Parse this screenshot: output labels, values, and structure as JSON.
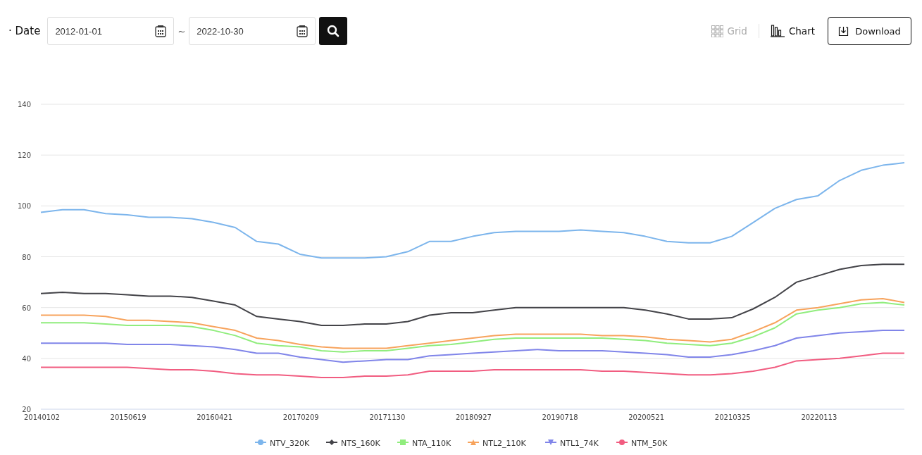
{
  "filter": {
    "label": "· Date",
    "start_date": "2012-01-01",
    "separator": "~",
    "end_date": "2022-10-30"
  },
  "view_tabs": [
    {
      "label": "Grid",
      "selected": false
    },
    {
      "label": "Chart",
      "selected": true
    }
  ],
  "download_button": "Download",
  "chart_data": {
    "type": "line",
    "categories": [
      "20140102",
      null,
      null,
      null,
      "20150619",
      null,
      null,
      null,
      "20160421",
      null,
      null,
      null,
      "20170209",
      null,
      null,
      null,
      "20171130",
      null,
      null,
      null,
      "20180927",
      null,
      null,
      null,
      "20190718",
      null,
      null,
      null,
      "20200521",
      null,
      null,
      null,
      "20210325",
      null,
      null,
      null,
      "20220113",
      null,
      null,
      null,
      null
    ],
    "ylim": [
      20,
      140
    ],
    "grid": true,
    "legend": "bottom",
    "yticks": [
      20,
      40,
      60,
      80,
      100,
      120,
      140
    ],
    "series": [
      {
        "name": "NTV_320K",
        "color": "#7cb5ec",
        "values": [
          97.5,
          98.5,
          98.5,
          97,
          96.5,
          95.5,
          95.5,
          95,
          93.5,
          91.5,
          86,
          85,
          81,
          79.5,
          79.5,
          79.5,
          80,
          82,
          86,
          86,
          88,
          89.5,
          90,
          90,
          90,
          90.5,
          90,
          89.5,
          88,
          86,
          85.5,
          85.5,
          88,
          93.5,
          99,
          102.5,
          104,
          110,
          114,
          116,
          117
        ]
      },
      {
        "name": "NTS_160K",
        "color": "#434348",
        "values": [
          65.5,
          66,
          65.5,
          65.5,
          65,
          64.5,
          64.5,
          64,
          62.5,
          61,
          56.5,
          55.5,
          54.5,
          53,
          53,
          53.5,
          53.5,
          54.5,
          57,
          58,
          58,
          59,
          60,
          60,
          60,
          60,
          60,
          60,
          59,
          57.5,
          55.5,
          55.5,
          56,
          59.5,
          64,
          70,
          72.5,
          75,
          76.5,
          77,
          77
        ]
      },
      {
        "name": "NTA_110K",
        "color": "#90ed7d",
        "values": [
          54,
          54,
          54,
          53.5,
          53,
          53,
          53,
          52.5,
          51,
          49,
          46,
          45,
          44.5,
          43,
          42.5,
          43,
          43,
          44,
          45,
          45.5,
          46.5,
          47.5,
          48,
          48,
          48,
          48,
          48,
          47.5,
          47,
          46,
          45.5,
          45,
          46,
          48.5,
          52,
          57.5,
          59,
          60,
          61.5,
          62,
          61
        ]
      },
      {
        "name": "NTL2_110K",
        "color": "#f7a35c",
        "values": [
          57,
          57,
          57,
          56.5,
          55,
          55,
          54.5,
          54,
          52.5,
          51,
          48,
          47,
          45.5,
          44.5,
          44,
          44,
          44,
          45,
          46,
          47,
          48,
          49,
          49.5,
          49.5,
          49.5,
          49.5,
          49,
          49,
          48.5,
          47.5,
          47,
          46.5,
          47.5,
          50.5,
          54,
          59,
          60,
          61.5,
          63,
          63.5,
          62
        ]
      },
      {
        "name": "NTL1_74K",
        "color": "#8085e9",
        "values": [
          46,
          46,
          46,
          46,
          45.5,
          45.5,
          45.5,
          45,
          44.5,
          43.5,
          42,
          42,
          40.5,
          39.5,
          38.5,
          39,
          39.5,
          39.5,
          41,
          41.5,
          42,
          42.5,
          43,
          43.5,
          43,
          43,
          43,
          42.5,
          42,
          41.5,
          40.5,
          40.5,
          41.5,
          43,
          45,
          48,
          49,
          50,
          50.5,
          51,
          51
        ]
      },
      {
        "name": "NTM_50K",
        "color": "#f15c80",
        "values": [
          36.5,
          36.5,
          36.5,
          36.5,
          36.5,
          36,
          35.5,
          35.5,
          35,
          34,
          33.5,
          33.5,
          33,
          32.5,
          32.5,
          33,
          33,
          33.5,
          35,
          35,
          35,
          35.5,
          35.5,
          35.5,
          35.5,
          35.5,
          35,
          35,
          34.5,
          34,
          33.5,
          33.5,
          34,
          35,
          36.5,
          39,
          39.5,
          40,
          41,
          42,
          42
        ]
      }
    ]
  }
}
